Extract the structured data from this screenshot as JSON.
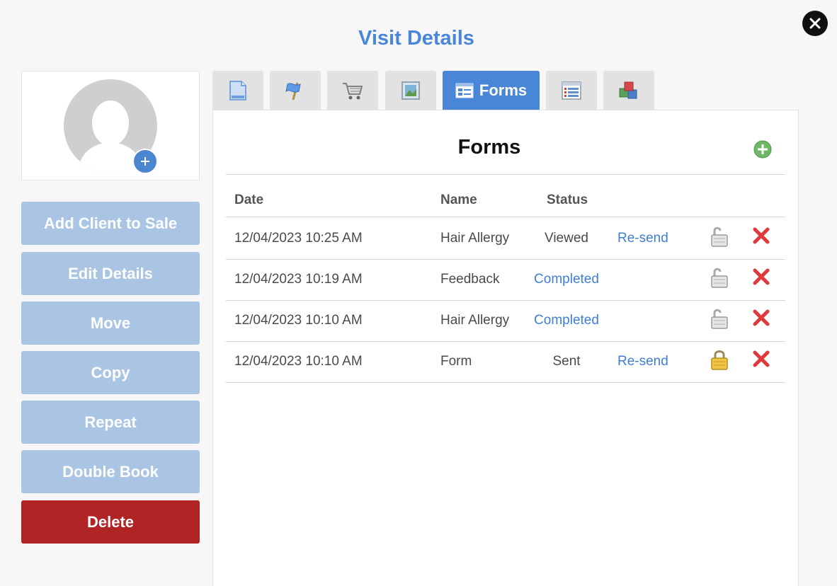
{
  "window": {
    "title": "Visit Details"
  },
  "sidebar": {
    "buttons": [
      {
        "label": "Add Client to Sale"
      },
      {
        "label": "Edit Details"
      },
      {
        "label": "Move"
      },
      {
        "label": "Copy"
      },
      {
        "label": "Repeat"
      },
      {
        "label": "Double Book"
      },
      {
        "label": "Delete"
      }
    ]
  },
  "tabs": [
    {
      "icon": "document-icon"
    },
    {
      "icon": "flag-icon"
    },
    {
      "icon": "cart-icon"
    },
    {
      "icon": "picture-icon"
    },
    {
      "icon": "form-icon",
      "label": "Forms",
      "active": true
    },
    {
      "icon": "list-icon"
    },
    {
      "icon": "boxes-icon"
    }
  ],
  "forms": {
    "title": "Forms",
    "columns": {
      "date": "Date",
      "name": "Name",
      "status": "Status"
    },
    "rows": [
      {
        "date": "12/04/2023 10:25 AM",
        "name": "Hair Allergy",
        "status": "Viewed",
        "status_link": false,
        "action": "Re-send",
        "locked": false
      },
      {
        "date": "12/04/2023 10:19 AM",
        "name": "Feedback",
        "status": "Completed",
        "status_link": true,
        "action": "",
        "locked": false
      },
      {
        "date": "12/04/2023 10:10 AM",
        "name": "Hair Allergy",
        "status": "Completed",
        "status_link": true,
        "action": "",
        "locked": false
      },
      {
        "date": "12/04/2023 10:10 AM",
        "name": "Form",
        "status": "Sent",
        "status_link": false,
        "action": "Re-send",
        "locked": true
      }
    ]
  },
  "colors": {
    "accent": "#4a86d8",
    "button": "#a9c5e3",
    "danger": "#b02426",
    "link": "#3f7ed6"
  }
}
